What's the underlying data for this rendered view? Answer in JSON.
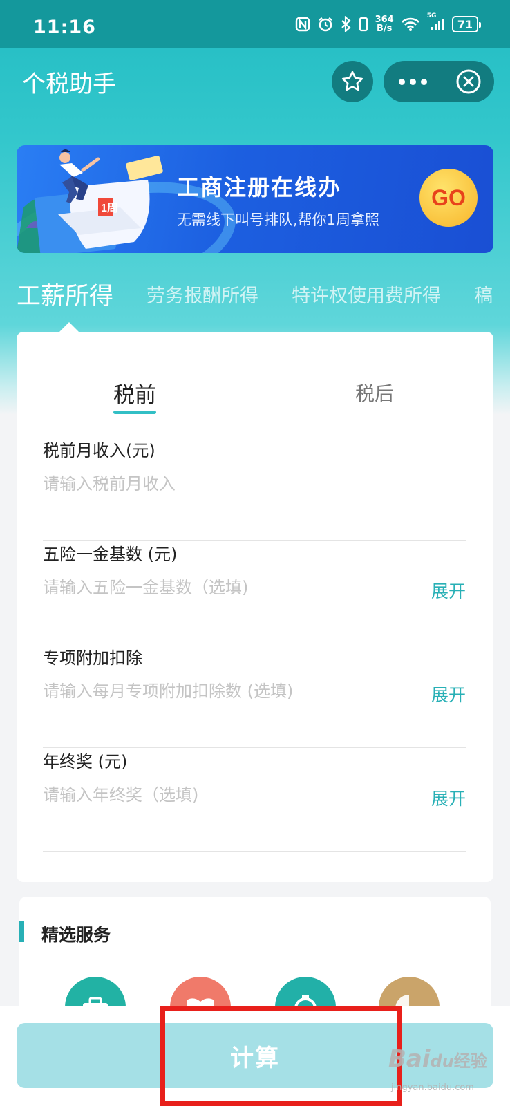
{
  "status_bar": {
    "time": "11:16",
    "net_speed_value": "364",
    "net_speed_unit": "B/s",
    "signal_label": "5G",
    "battery": "71"
  },
  "header": {
    "title": "个税助手"
  },
  "banner": {
    "title": "工商注册在线办",
    "subtitle": "无需线下叫号排队,帮你1周拿照",
    "cta": "GO",
    "illustration_text": "1周"
  },
  "income_tabs": [
    {
      "label": "工薪所得",
      "active": true
    },
    {
      "label": "劳务报酬所得",
      "active": false
    },
    {
      "label": "特许权使用费所得",
      "active": false
    },
    {
      "label": "稿",
      "active": false
    }
  ],
  "calculator": {
    "mode_tabs": {
      "before": "税前",
      "after": "税后",
      "selected": "税前"
    },
    "fields": [
      {
        "label": "税前月收入(元)",
        "placeholder": "请输入税前月收入",
        "value": "",
        "expand": ""
      },
      {
        "label": "五险一金基数 (元)",
        "placeholder": "请输入五险一金基数（选填)",
        "value": "",
        "expand": "展开"
      },
      {
        "label": "专项附加扣除",
        "placeholder": "请输入每月专项附加扣除数 (选填)",
        "value": "",
        "expand": "展开"
      },
      {
        "label": "年终奖 (元)",
        "placeholder": "请输入年终奖（选填)",
        "value": "",
        "expand": "展开"
      }
    ]
  },
  "services": {
    "title": "精选服务",
    "icon_colors": [
      "#22b2a4",
      "#f07a6a",
      "#22b0a8",
      "#caa46a"
    ]
  },
  "action": {
    "calculate_label": "计算"
  },
  "watermark": {
    "main": "Bai",
    "paw": "du",
    "suffix": "经验",
    "url": "jingyan.baidu.com"
  },
  "colors": {
    "accent": "#28b0b6",
    "header": "#14989c",
    "banner": "#1c5fe0",
    "button_disabled": "#a5e0e6",
    "highlight": "#e8201b"
  }
}
